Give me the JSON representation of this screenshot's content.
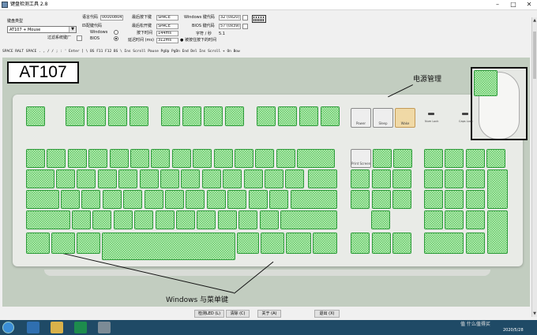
{
  "window": {
    "title": "键盘检测工具 2.8"
  },
  "controls": {
    "keyboard_type_label": "键盘类型",
    "keyboard_type_value": "AT107 + Mouse",
    "filter_label": "过滤系统键厂",
    "scancode_label": "语言代码",
    "scancode_value": "00000804",
    "match_label": "匹配键代码",
    "mode_windows": "Windows",
    "mode_bios": "BIOS",
    "last_down_label": "最后按下键",
    "last_down_value": "SPACE",
    "last_up_label": "最后松开键",
    "last_up_value": "SPACE",
    "press_time_label": "按下时间",
    "press_time_value": "144ms",
    "release_time_label": "延迟时间 (ms)",
    "release_time_value": "312ms",
    "win_code_label": "Windows 键代码",
    "win_code_value": "32 (0x20)",
    "bios_code_label": "BIOS 键代码",
    "bios_code_value": "57 (0x39)",
    "rate_label": "字符 / 秒",
    "rate_value": "5.1",
    "repeat_label": "被按住按下的时间"
  },
  "key_log": "SPACE RALT SPACE . , / / ; : ' Enter ] \\ BS F11 F12 BS \\ Ins Scroll Pause PgUp PgDn End Del Ins Scroll + On Bow",
  "model_name": "AT107",
  "annotations": {
    "power_management": "电源管理",
    "windows_menu_keys": "Windows 与菜单键"
  },
  "power_keys": [
    "Power",
    "Sleep",
    "Wake"
  ],
  "locks": [
    "Num Lock",
    "Caps Lock",
    "Scroll Lock"
  ],
  "edit_labels": {
    "print_screen": "Print Screen"
  },
  "buttons": {
    "test_led": "检测LED (L)",
    "clear": "清除 (C)",
    "about": "关于 (A)",
    "exit": "退出 (X)"
  },
  "taskbar": {
    "time": "",
    "date": "2020/5/28",
    "watermark": "值 什么值得买"
  },
  "colors": {
    "tested_key": "#8fe08f",
    "panel_bg": "#c2cdc0",
    "taskbar": "#1f4a66"
  }
}
